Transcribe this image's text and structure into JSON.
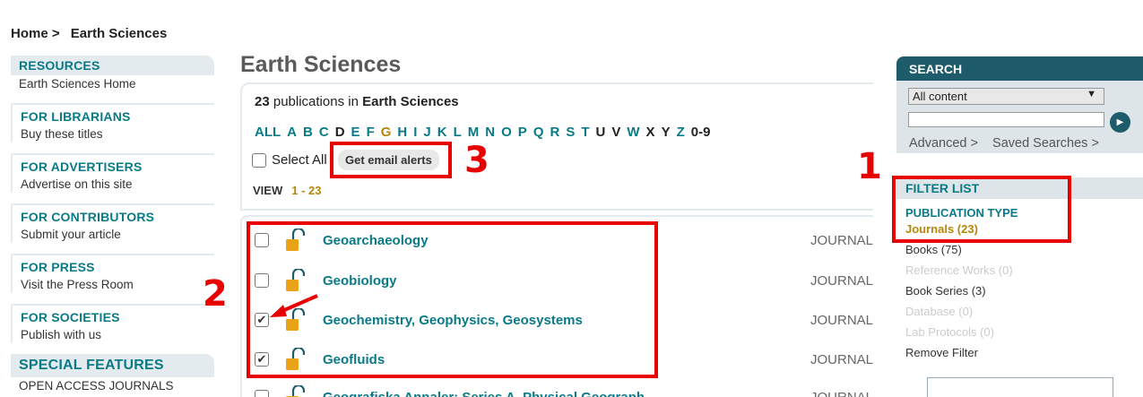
{
  "breadcrumb": {
    "home": "Home >",
    "current": "Earth Sciences"
  },
  "sidebar": {
    "sections": [
      {
        "heading": "RESOURCES",
        "link": "Earth Sciences Home"
      },
      {
        "heading": "FOR LIBRARIANS",
        "link": "Buy these titles"
      },
      {
        "heading": "FOR ADVERTISERS",
        "link": "Advertise on this site"
      },
      {
        "heading": "FOR CONTRIBUTORS",
        "link": "Submit your article"
      },
      {
        "heading": "FOR PRESS",
        "link": "Visit the Press Room"
      },
      {
        "heading": "FOR SOCIETIES",
        "link": "Publish with us"
      },
      {
        "heading": "SPECIAL FEATURES",
        "link": "OPEN ACCESS JOURNALS"
      }
    ]
  },
  "main": {
    "title": "Earth Sciences",
    "count_number": "23",
    "count_text": " publications in ",
    "count_subject": "Earth Sciences",
    "alphabet": [
      "ALL",
      "A",
      "B",
      "C",
      "D",
      "E",
      "F",
      "G",
      "H",
      "I",
      "J",
      "K",
      "L",
      "M",
      "N",
      "O",
      "P",
      "Q",
      "R",
      "S",
      "T",
      "U",
      "V",
      "W",
      "X",
      "Y",
      "Z",
      "0-9"
    ],
    "select_all": "Select All",
    "email_alerts": "Get email alerts",
    "view_label": "VIEW",
    "view_range": "1 - 23",
    "rows": [
      {
        "title": "Geoarchaeology",
        "type": "JOURNAL",
        "checked": false
      },
      {
        "title": "Geobiology",
        "type": "JOURNAL",
        "checked": false
      },
      {
        "title": "Geochemistry, Geophysics, Geosystems",
        "type": "JOURNAL",
        "checked": true
      },
      {
        "title": "Geofluids",
        "type": "JOURNAL",
        "checked": true
      },
      {
        "title": "Geografiska Annaler: Series A, Physical Geograph",
        "type": "JOURNAL",
        "checked": false
      }
    ]
  },
  "search": {
    "heading": "SEARCH",
    "scope": "All content",
    "advanced": "Advanced >",
    "saved": "Saved Searches >"
  },
  "filter": {
    "heading": "FILTER LIST",
    "subheading": "PUBLICATION TYPE",
    "items": [
      {
        "label": "Journals (23)",
        "state": "active"
      },
      {
        "label": "Books (75)",
        "state": "normal"
      },
      {
        "label": "Reference Works (0)",
        "state": "disabled"
      },
      {
        "label": "Book Series (3)",
        "state": "normal"
      },
      {
        "label": "Database (0)",
        "state": "disabled"
      },
      {
        "label": "Lab Protocols (0)",
        "state": "disabled"
      },
      {
        "label": "Remove Filter",
        "state": "normal"
      }
    ]
  },
  "annotations": {
    "one": "1",
    "two": "2",
    "three": "3"
  },
  "colors": {
    "accent": "#0a7a87",
    "active": "#b8860b",
    "annotation": "#e80000",
    "search_header": "#1e5c6b"
  }
}
